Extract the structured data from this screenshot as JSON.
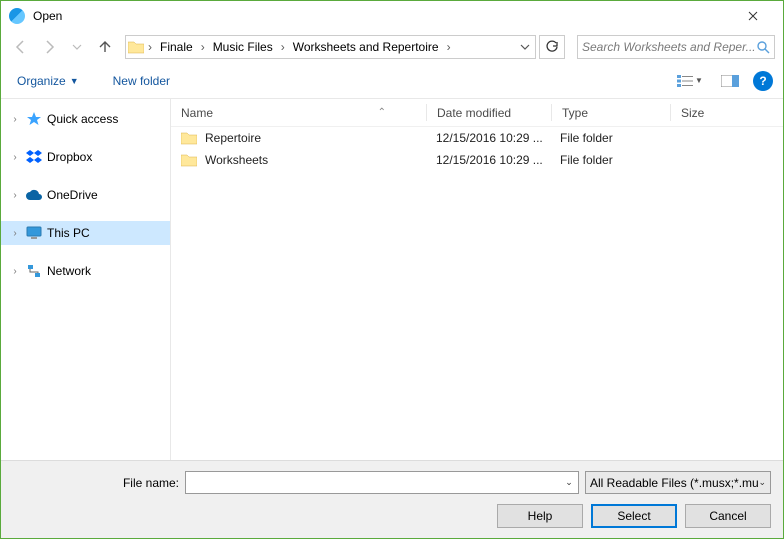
{
  "window": {
    "title": "Open"
  },
  "breadcrumb": {
    "items": [
      "Finale",
      "Music Files",
      "Worksheets and Repertoire"
    ]
  },
  "search": {
    "placeholder": "Search Worksheets and Reper..."
  },
  "toolbar": {
    "organize": "Organize",
    "newfolder": "New folder"
  },
  "nav": {
    "items": [
      {
        "label": "Quick access",
        "icon": "star"
      },
      {
        "label": "Dropbox",
        "icon": "dropbox"
      },
      {
        "label": "OneDrive",
        "icon": "onedrive"
      },
      {
        "label": "This PC",
        "icon": "monitor",
        "selected": true
      },
      {
        "label": "Network",
        "icon": "network"
      }
    ]
  },
  "columns": {
    "name": "Name",
    "date": "Date modified",
    "type": "Type",
    "size": "Size"
  },
  "rows": [
    {
      "name": "Repertoire",
      "date": "12/15/2016 10:29 ...",
      "type": "File folder"
    },
    {
      "name": "Worksheets",
      "date": "12/15/2016 10:29 ...",
      "type": "File folder"
    }
  ],
  "bottom": {
    "filename_label": "File name:",
    "filter": "All Readable Files (*.musx;*.mu",
    "help": "Help",
    "select": "Select",
    "cancel": "Cancel"
  },
  "help_glyph": "?"
}
